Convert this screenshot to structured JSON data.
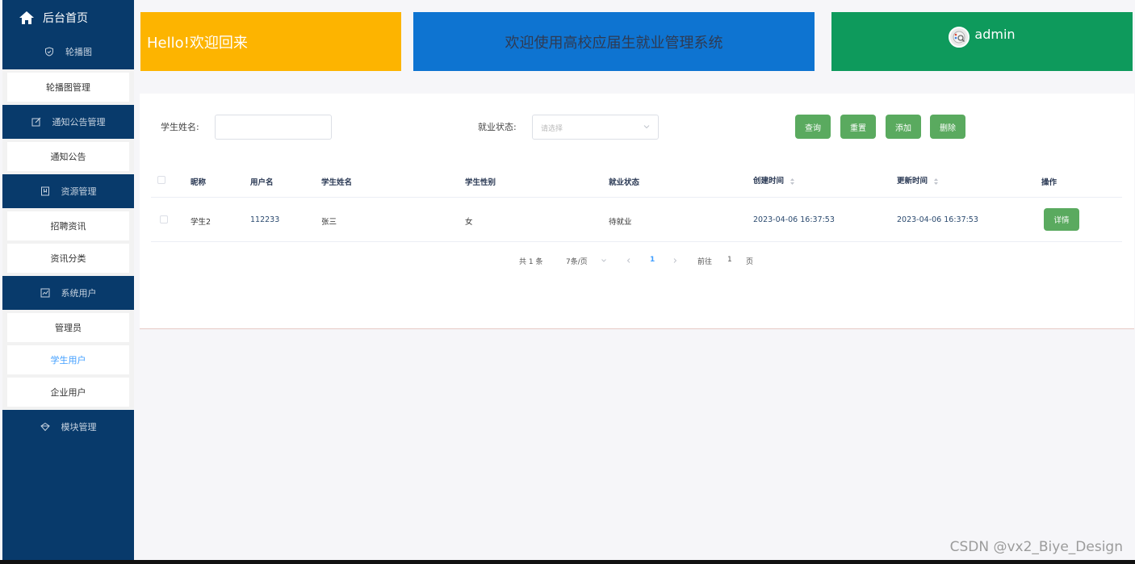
{
  "sidebar": {
    "home_label": "后台首页",
    "groups": [
      {
        "title": "轮播图",
        "icon": "shield-icon",
        "items": [
          "轮播图管理"
        ]
      },
      {
        "title": "通知公告管理",
        "icon": "edit-icon",
        "items": [
          "通知公告"
        ]
      },
      {
        "title": "资源管理",
        "icon": "bookmark-icon",
        "items": [
          "招聘资讯",
          "资讯分类"
        ]
      },
      {
        "title": "系统用户",
        "icon": "chart-icon",
        "items": [
          "管理员",
          "学生用户",
          "企业用户"
        ]
      },
      {
        "title": "模块管理",
        "icon": "diamond-icon",
        "items": []
      }
    ],
    "active_item": "学生用户"
  },
  "header": {
    "hello": "Hello!欢迎回来",
    "welcome": "欢迎使用高校应届生就业管理系统",
    "username": "admin"
  },
  "search": {
    "name_label": "学生姓名:",
    "name_value": "",
    "status_label": "就业状态:",
    "status_placeholder": "请选择",
    "buttons": {
      "query": "查询",
      "reset": "重置",
      "add": "添加",
      "delete": "删除"
    }
  },
  "table": {
    "headers": {
      "nickname": "昵称",
      "username": "用户名",
      "student_name": "学生姓名",
      "gender": "学生性别",
      "status": "就业状态",
      "created": "创建时间",
      "updated": "更新时间",
      "action": "操作"
    },
    "rows": [
      {
        "nickname": "学生2",
        "username": "112233",
        "student_name": "张三",
        "gender": "女",
        "status": "待就业",
        "created": "2023-04-06 16:37:53",
        "updated": "2023-04-06 16:37:53",
        "action": "详情"
      }
    ]
  },
  "pagination": {
    "total": "共 1 条",
    "page_size": "7条/页",
    "current_page": "1",
    "goto_label": "前往",
    "goto_value": "1",
    "page_suffix": "页"
  },
  "watermark": "CSDN @vx2_Biye_Design",
  "colors": {
    "sidebar": "#083a6b",
    "hello_card": "#fdb400",
    "welcome_card": "#0e74d1",
    "user_card": "#0e9a5c",
    "button": "#5aaa5f",
    "active": "#409eff"
  }
}
